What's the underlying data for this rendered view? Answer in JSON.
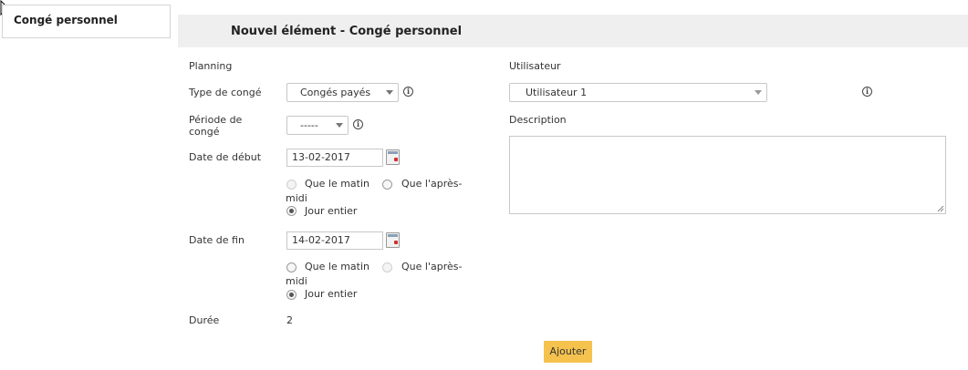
{
  "sidebar": {
    "tab_label": "Congé personnel"
  },
  "header": {
    "title": "Nouvel élément - Congé personnel"
  },
  "form": {
    "planning_label": "Planning",
    "type_label": "Type de congé",
    "type_value": "Congés payés",
    "periode_label_line1": "Période de",
    "periode_label_line2": "congé",
    "periode_value": "-----",
    "date_debut_label": "Date de début",
    "date_debut_value": "13-02-2017",
    "date_fin_label": "Date de fin",
    "date_fin_value": "14-02-2017",
    "opt_matin": "Que le matin",
    "opt_apres_line1": "Que l'après-",
    "opt_apres_line2": "midi",
    "opt_jour": "Jour entier",
    "duree_label": "Durée",
    "duree_value": "2",
    "utilisateur_label": "Utilisateur",
    "utilisateur_value": "Utilisateur 1",
    "description_label": "Description",
    "description_value": "",
    "submit_label": "Ajouter"
  },
  "icons": {
    "info": "info-icon",
    "calendar": "calendar-icon",
    "caret": "chevron-down-icon"
  },
  "colors": {
    "accent_button": "#f5c24e",
    "header_bg": "#efefef"
  }
}
